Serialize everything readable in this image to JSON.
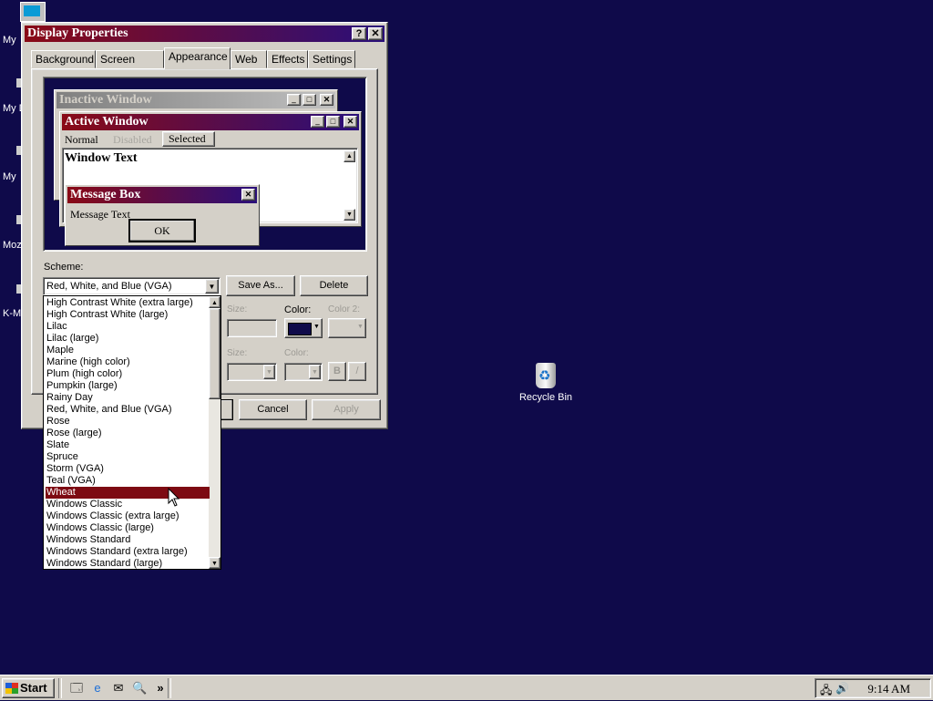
{
  "desktop": {
    "icons": [
      {
        "label": "My"
      },
      {
        "label": "My D"
      },
      {
        "label": "My"
      },
      {
        "label": "Moz"
      },
      {
        "label": "K-M"
      }
    ],
    "recycle_bin": "Recycle Bin"
  },
  "dialog": {
    "title": "Display Properties",
    "help_btn": "?",
    "close_btn": "✕",
    "tabs": [
      "Background",
      "Screen Saver",
      "Appearance",
      "Web",
      "Effects",
      "Settings"
    ],
    "active_tab": "Appearance",
    "preview": {
      "inactive_title": "Inactive Window",
      "active_title": "Active Window",
      "menu": [
        "Normal",
        "Disabled",
        "Selected"
      ],
      "window_text": "Window Text",
      "msgbox_title": "Message Box",
      "msgbox_text": "Message Text",
      "ok": "OK"
    },
    "scheme_label": "Scheme:",
    "scheme_value": "Red, White, and Blue (VGA)",
    "save_as": "Save As...",
    "delete": "Delete",
    "size_label": "Size:",
    "color_label": "Color:",
    "color2_label": "Color 2:",
    "size2_label": "Size:",
    "color3_label": "Color:",
    "bold": "B",
    "italic": "/",
    "cancel": "Cancel",
    "apply": "Apply",
    "colors": {
      "title_start": "#8a0a16",
      "title_end": "#2a0f7a",
      "selected_item": "#7d0a12",
      "desktop": "#0f0a4a"
    }
  },
  "scheme_list": {
    "items": [
      "High Contrast White (extra large)",
      "High Contrast White (large)",
      "Lilac",
      "Lilac (large)",
      "Maple",
      "Marine (high color)",
      "Plum (high color)",
      "Pumpkin (large)",
      "Rainy Day",
      "Red, White, and Blue (VGA)",
      "Rose",
      "Rose (large)",
      "Slate",
      "Spruce",
      "Storm (VGA)",
      "Teal (VGA)",
      "Wheat",
      "Windows Classic",
      "Windows Classic (extra large)",
      "Windows Classic (large)",
      "Windows Standard",
      "Windows Standard (extra large)",
      "Windows Standard (large)"
    ],
    "selected": "Wheat"
  },
  "taskbar": {
    "start": "Start",
    "chevron": "»",
    "clock": "9:14 AM"
  }
}
